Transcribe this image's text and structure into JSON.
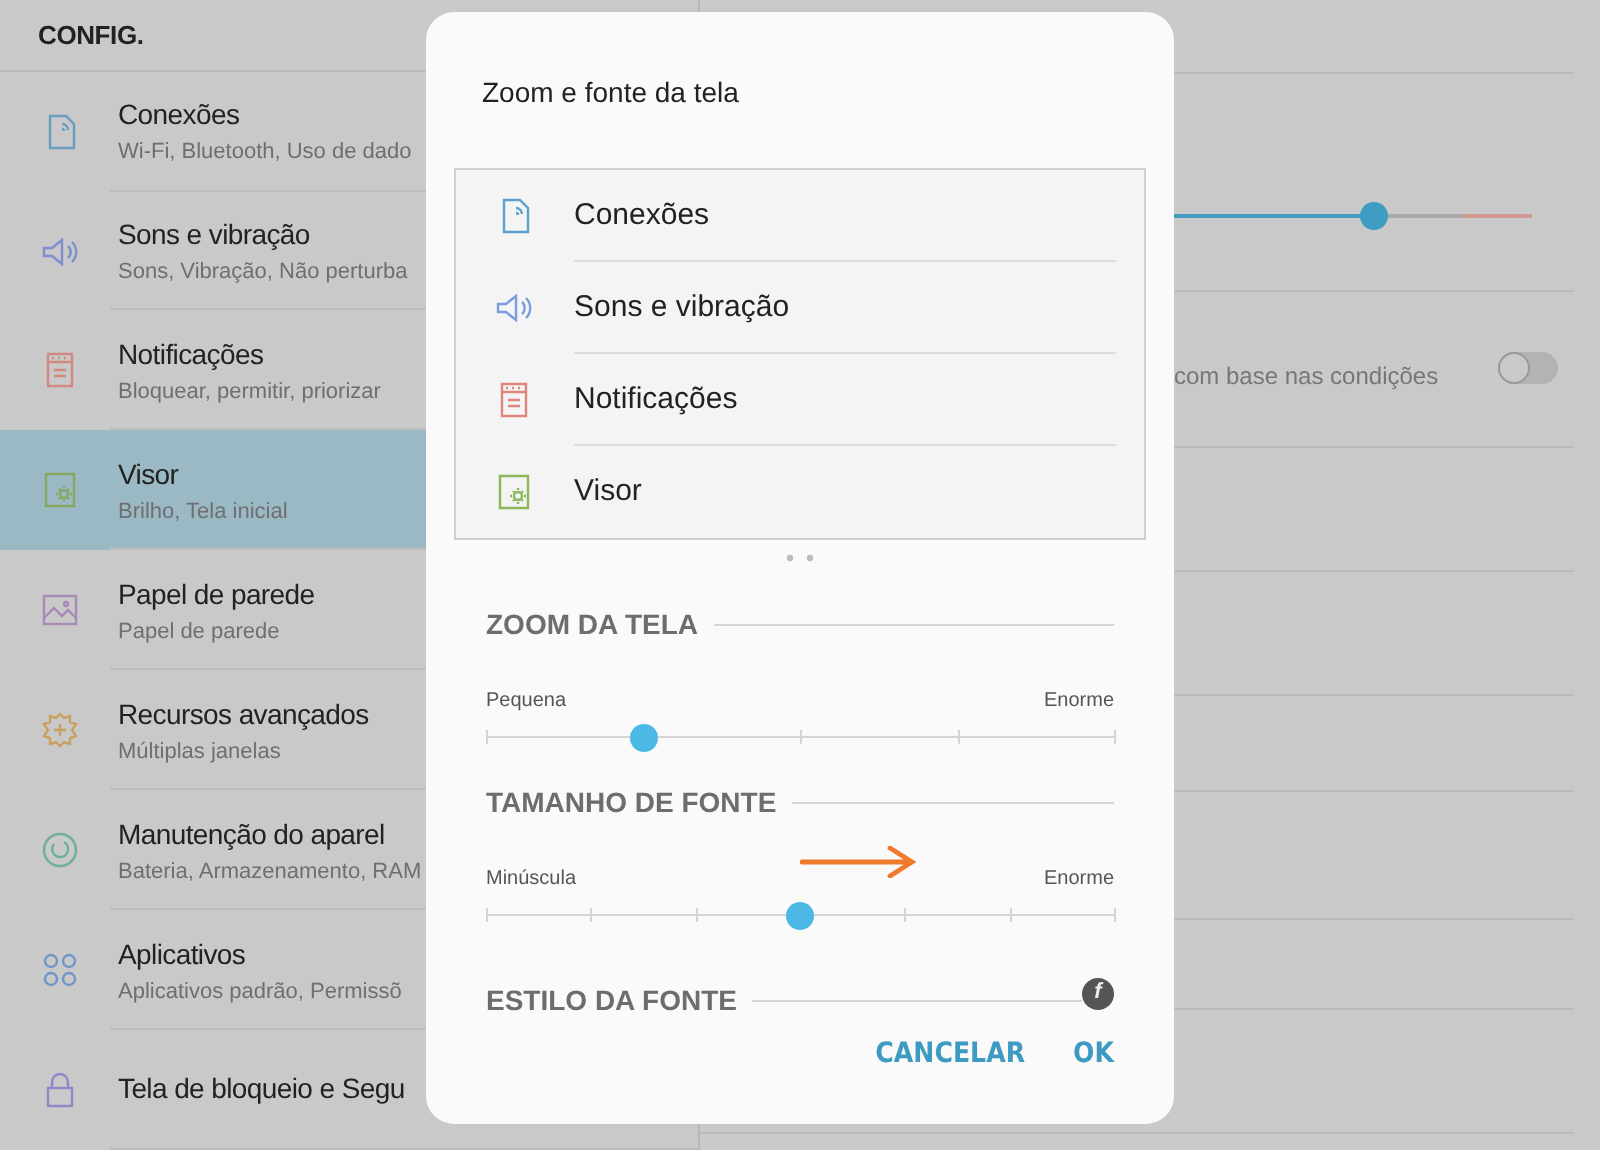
{
  "sidebar": {
    "title": "CONFIG.",
    "items": [
      {
        "kind": "connections",
        "color": "#6a9ec0",
        "title": "Conexões",
        "subtitle": "Wi-Fi, Bluetooth, Uso de dado",
        "selected": false
      },
      {
        "kind": "sound",
        "color": "#7f8fcc",
        "title": "Sons e vibração",
        "subtitle": "Sons, Vibração, Não perturba",
        "selected": false
      },
      {
        "kind": "notifications",
        "color": "#d08a80",
        "title": "Notificações",
        "subtitle": "Bloquear, permitir, priorizar",
        "selected": false
      },
      {
        "kind": "display",
        "color": "#86a860",
        "title": "Visor",
        "subtitle": "Brilho, Tela inicial",
        "selected": true
      },
      {
        "kind": "wallpaper",
        "color": "#a88ab8",
        "title": "Papel de parede",
        "subtitle": "Papel de parede",
        "selected": false
      },
      {
        "kind": "advanced",
        "color": "#c8a060",
        "title": "Recursos avançados",
        "subtitle": "Múltiplas janelas",
        "selected": false
      },
      {
        "kind": "maintenance",
        "color": "#6eae9c",
        "title": "Manutenção do aparel",
        "subtitle": "Bateria, Armazenamento, RAM",
        "selected": false
      },
      {
        "kind": "apps",
        "color": "#6f96c8",
        "title": "Aplicativos",
        "subtitle": "Aplicativos padrão, Permissõ",
        "selected": false
      },
      {
        "kind": "lock",
        "color": "#8f88c8",
        "title": "Tela de bloqueio e Segu",
        "selected": false
      }
    ]
  },
  "detail": {
    "brightness": {
      "level": 0.8
    },
    "adaptive": {
      "text": "com base nas condições",
      "on": false
    }
  },
  "dialog": {
    "title": "Zoom e fonte da tela",
    "preview": [
      {
        "kind": "connections",
        "color": "#5aa0d0",
        "label": "Conexões"
      },
      {
        "kind": "sound",
        "color": "#7f9be0",
        "label": "Sons e vibração"
      },
      {
        "kind": "notifications",
        "color": "#e0857a",
        "label": "Notificações"
      },
      {
        "kind": "display",
        "color": "#8cb85a",
        "label": "Visor"
      }
    ],
    "sections": [
      {
        "heading": "ZOOM DA TELA",
        "slider": {
          "kind": "five-step",
          "min_label": "Pequena",
          "max_label": "Enorme",
          "level": 0.25
        }
      },
      {
        "heading": "TAMANHO DE FONTE",
        "slider": {
          "kind": "seven-step",
          "min_label": "Minúscula",
          "max_label": "Enorme",
          "level": 0.5
        }
      },
      {
        "heading": "ESTILO DA FONTE",
        "badge": "f"
      }
    ],
    "buttons": [
      "CANCELAR",
      "OK"
    ]
  }
}
